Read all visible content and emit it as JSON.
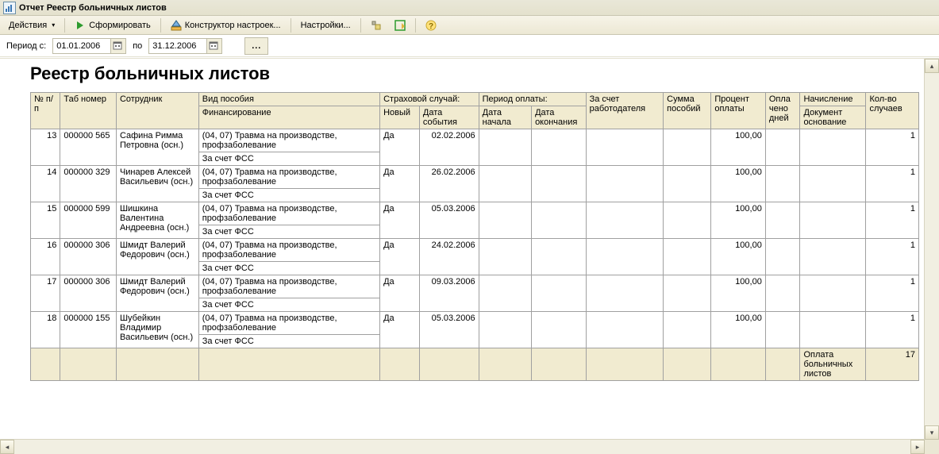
{
  "window": {
    "title": "Отчет  Реестр больничных листов"
  },
  "toolbar": {
    "actions_label": "Действия",
    "run_label": "Сформировать",
    "constructor_label": "Конструктор настроек...",
    "settings_label": "Настройки..."
  },
  "params": {
    "period_from_label": "Период с:",
    "period_to_label": "по",
    "date_from": "01.01.2006",
    "date_to": "31.12.2006",
    "ellipsis": "..."
  },
  "report": {
    "title": "Реестр больничных листов",
    "headers": {
      "num": "№ п/п",
      "tab_no": "Таб номер",
      "employee": "Сотрудник",
      "benefit_type": "Вид пособия",
      "financing": "Финансирование",
      "ins_case": "Страховой случай:",
      "new": "Новый",
      "event_date": "Дата события",
      "pay_period": "Период оплаты:",
      "date_start": "Дата начала",
      "date_end": "Дата окончания",
      "at_employer": "За счет работодателя",
      "benefit_sum": "Сумма пособий",
      "pay_percent": "Процент оплаты",
      "paid_days": "Опла чено дней",
      "accrual": "Начисление",
      "doc_basis": "Документ основание",
      "count": "Кол-во случаев"
    },
    "rows": [
      {
        "num": "13",
        "tab_no": "000000 565",
        "employee": "Сафина Римма Петровна (осн.)",
        "benefit_type": "(04, 07) Травма на производстве, профзаболевание",
        "financing": "За счет ФСС",
        "new": "Да",
        "event_date": "02.02.2006",
        "date_start": "",
        "date_end": "",
        "at_employer": "",
        "benefit_sum": "",
        "pay_percent": "100,00",
        "paid_days": "",
        "doc_basis": "",
        "count": "1"
      },
      {
        "num": "14",
        "tab_no": "000000 329",
        "employee": "Чинарев Алексей Васильевич (осн.)",
        "benefit_type": "(04, 07) Травма на производстве, профзаболевание",
        "financing": "За счет ФСС",
        "new": "Да",
        "event_date": "26.02.2006",
        "date_start": "",
        "date_end": "",
        "at_employer": "",
        "benefit_sum": "",
        "pay_percent": "100,00",
        "paid_days": "",
        "doc_basis": "",
        "count": "1"
      },
      {
        "num": "15",
        "tab_no": "000000 599",
        "employee": "Шишкина Валентина Андреевна (осн.)",
        "benefit_type": "(04, 07) Травма на производстве, профзаболевание",
        "financing": "За счет ФСС",
        "new": "Да",
        "event_date": "05.03.2006",
        "date_start": "",
        "date_end": "",
        "at_employer": "",
        "benefit_sum": "",
        "pay_percent": "100,00",
        "paid_days": "",
        "doc_basis": "",
        "count": "1"
      },
      {
        "num": "16",
        "tab_no": "000000 306",
        "employee": "Шмидт Валерий Федорович (осн.)",
        "benefit_type": "(04, 07) Травма на производстве, профзаболевание",
        "financing": "За счет ФСС",
        "new": "Да",
        "event_date": "24.02.2006",
        "date_start": "",
        "date_end": "",
        "at_employer": "",
        "benefit_sum": "",
        "pay_percent": "100,00",
        "paid_days": "",
        "doc_basis": "",
        "count": "1"
      },
      {
        "num": "17",
        "tab_no": "000000 306",
        "employee": "Шмидт Валерий Федорович (осн.)",
        "benefit_type": "(04, 07) Травма на производстве, профзаболевание",
        "financing": "За счет ФСС",
        "new": "Да",
        "event_date": "09.03.2006",
        "date_start": "",
        "date_end": "",
        "at_employer": "",
        "benefit_sum": "",
        "pay_percent": "100,00",
        "paid_days": "",
        "doc_basis": "",
        "count": "1"
      },
      {
        "num": "18",
        "tab_no": "000000 155",
        "employee": "Шубейкин Владимир Васильевич (осн.)",
        "benefit_type": "(04, 07) Травма на производстве, профзаболевание",
        "financing": "За счет ФСС",
        "new": "Да",
        "event_date": "05.03.2006",
        "date_start": "",
        "date_end": "",
        "at_employer": "",
        "benefit_sum": "",
        "pay_percent": "100,00",
        "paid_days": "",
        "doc_basis": "",
        "count": "1"
      }
    ],
    "footer": {
      "doc_basis": "Оплата больничных листов",
      "count": "17"
    },
    "outline_collapse": "–"
  }
}
